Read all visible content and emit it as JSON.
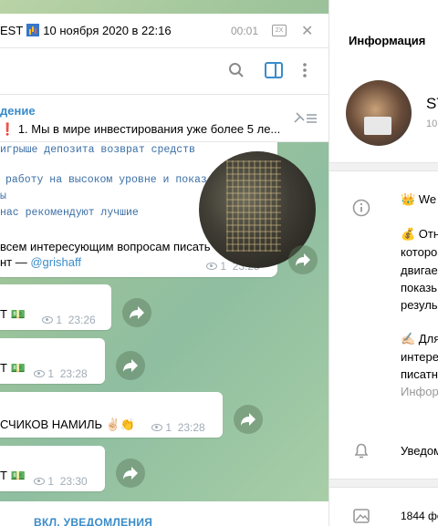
{
  "player": {
    "title": "EST",
    "date": "10 ноября 2020 в 22:16",
    "time": "00:01",
    "speed": "2X"
  },
  "pinned": {
    "title": "дение",
    "text": "1. Мы в мире инвестирования уже более 5 ле..."
  },
  "post": {
    "lines": [
      "игрыше депозита возврат средств",
      "работу на высоком уровне и показ",
      "ы",
      "нас рекомендуют лучшие"
    ],
    "text_line1": "всем интересующим вопросам писать",
    "text_line2_prefix": "нт — ",
    "link": "@grishaff",
    "views": "1",
    "time": "23:25"
  },
  "messages": [
    {
      "text": "Т 💵",
      "views": "1",
      "time": "23:26"
    },
    {
      "text": "Т 💵",
      "views": "1",
      "time": "23:28"
    },
    {
      "text": "СЧИКОВ НАМИЛЬ ✌🏻👏",
      "views": "1",
      "time": "23:28"
    },
    {
      "text": "Т 💵",
      "views": "1",
      "time": "23:30"
    }
  ],
  "bottom": {
    "label": "ВКЛ. УВЕДОМЛЕНИЯ"
  },
  "info": {
    "header": "Информация",
    "name": "ST",
    "subtitle": "10",
    "desc": [
      "👑 We",
      "💰 Отн",
      "которо",
      "двигае",
      "показь",
      "резуль",
      "✍🏻 Для",
      "интере",
      "писатн",
      "Инфор"
    ],
    "notifications": "Уведом",
    "photos": "1844 фо"
  },
  "colors": {
    "accent": "#3a8cca",
    "meta": "#a0acb6"
  }
}
